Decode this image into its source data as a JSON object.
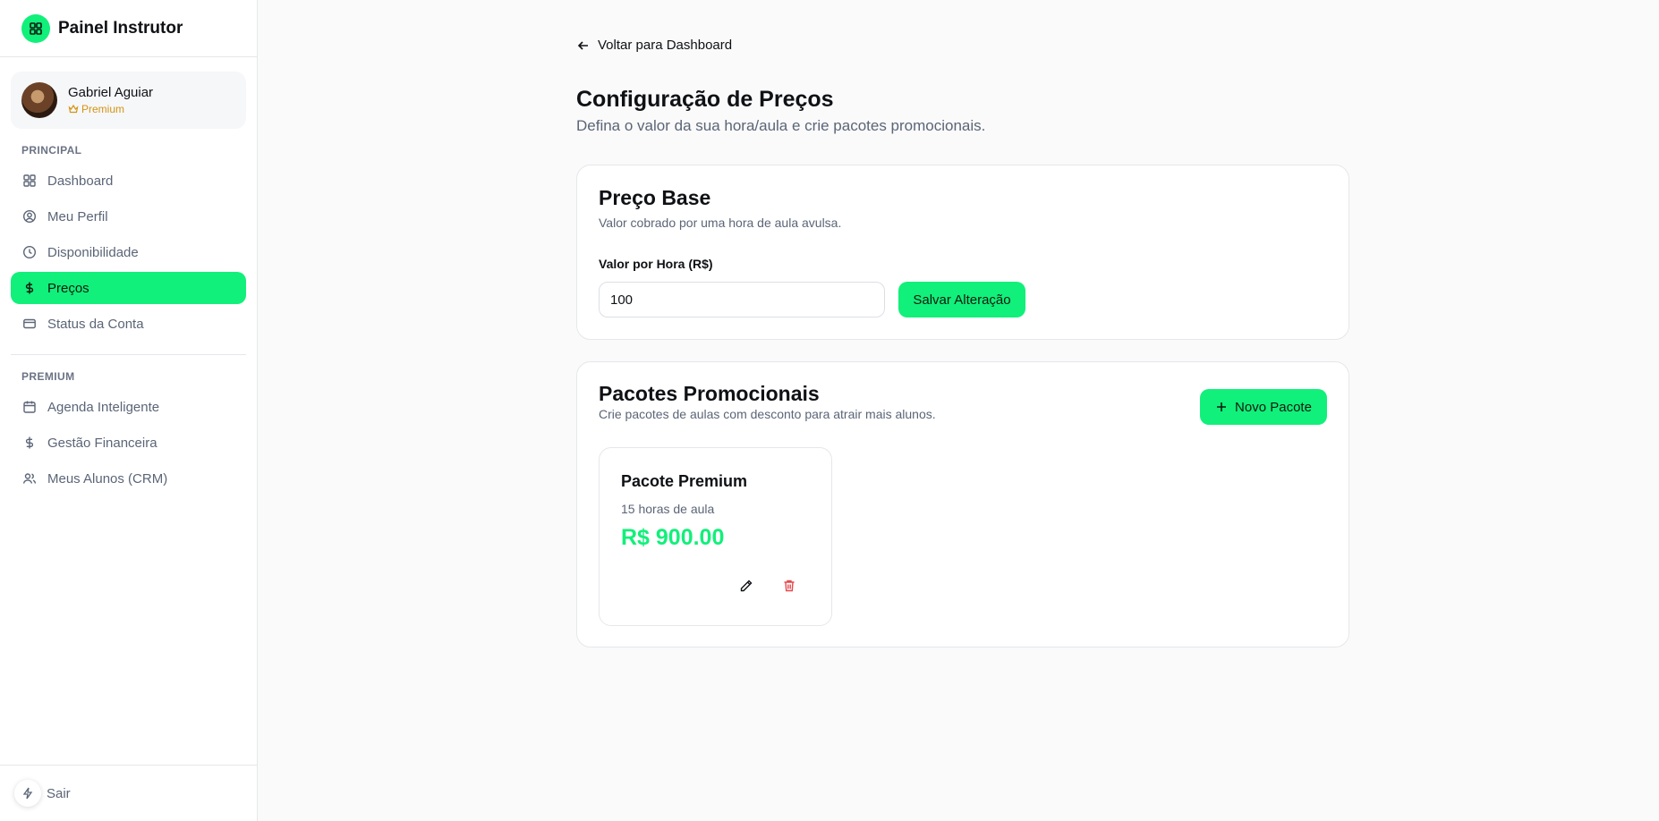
{
  "sidebar": {
    "brand_title": "Painel Instrutor",
    "profile": {
      "name": "Gabriel Aguiar",
      "plan": "Premium"
    },
    "section_principal": "PRINCIPAL",
    "section_premium": "PREMIUM",
    "nav_principal": [
      {
        "label": "Dashboard",
        "icon": "grid-icon",
        "active": false
      },
      {
        "label": "Meu Perfil",
        "icon": "user-circle-icon",
        "active": false
      },
      {
        "label": "Disponibilidade",
        "icon": "clock-icon",
        "active": false
      },
      {
        "label": "Preços",
        "icon": "dollar-icon",
        "active": true
      },
      {
        "label": "Status da Conta",
        "icon": "credit-card-icon",
        "active": false
      }
    ],
    "nav_premium": [
      {
        "label": "Agenda Inteligente",
        "icon": "calendar-icon"
      },
      {
        "label": "Gestão Financeira",
        "icon": "dollar-icon"
      },
      {
        "label": "Meus Alunos (CRM)",
        "icon": "users-icon"
      }
    ],
    "logout_label": "Sair"
  },
  "main": {
    "back_label": "Voltar para Dashboard",
    "title": "Configuração de Preços",
    "subtitle": "Defina o valor da sua hora/aula e crie pacotes promocionais."
  },
  "base_price": {
    "title": "Preço Base",
    "subtitle": "Valor cobrado por uma hora de aula avulsa.",
    "field_label": "Valor por Hora (R$)",
    "field_value": "100",
    "save_label": "Salvar Alteração"
  },
  "packages": {
    "title": "Pacotes Promocionais",
    "subtitle": "Crie pacotes de aulas com desconto para atrair mais alunos.",
    "new_label": "Novo Pacote",
    "items": [
      {
        "name": "Pacote Premium",
        "hours": "15 horas de aula",
        "price": "R$ 900.00"
      }
    ]
  },
  "colors": {
    "accent": "#11f07a",
    "premium": "#d39414",
    "danger": "#e5484d",
    "muted": "#5b6577"
  }
}
